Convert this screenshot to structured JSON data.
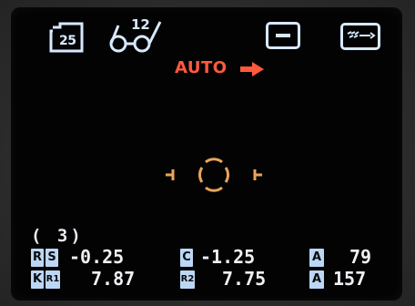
{
  "display": {
    "accent_color": "#ff5a3c",
    "text_color": "#f0f0f4",
    "icon_color": "#d7e9ff",
    "tag_color": "#bcd7f5"
  },
  "top_icons": {
    "badge_icon": "memory-card-icon",
    "badge_value": "25",
    "glasses_icon": "glasses-icon",
    "glasses_value": "12",
    "mode_icon": "minus-box-icon",
    "fixation_icon": "eye-fixation-icon"
  },
  "mode": {
    "label": "AUTO",
    "arrow_icon": "arrow-right-icon"
  },
  "target_icon": "alignment-target-icon",
  "measurement_count": "( 3)",
  "readings": {
    "row1": {
      "tag1": "R",
      "tag2": "S",
      "sphere": "-0.25",
      "tag_c": "C",
      "cylinder": "-1.25",
      "tag_a": "A",
      "axis": "79"
    },
    "row2": {
      "tag1": "K",
      "tag2": "R1",
      "r1": "7.87",
      "tag_r2": "R2",
      "r2": "7.75",
      "tag_a": "A",
      "axis": "157"
    }
  }
}
